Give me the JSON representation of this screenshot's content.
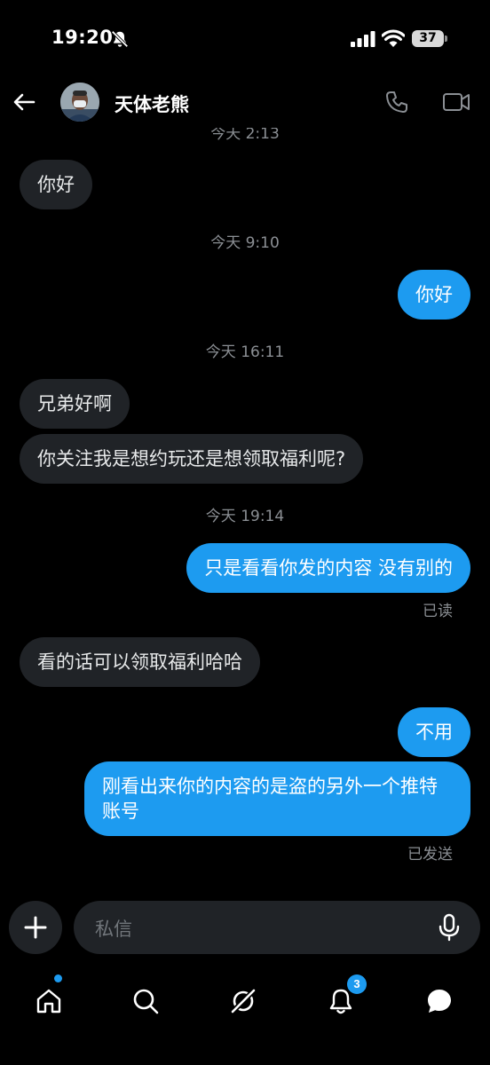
{
  "status_bar": {
    "time": "19:20",
    "battery": "37"
  },
  "header": {
    "contact_name": "天体老熊"
  },
  "messages": [
    {
      "kind": "timestamp",
      "text": "今天 2:13"
    },
    {
      "kind": "incoming",
      "text": "你好"
    },
    {
      "kind": "timestamp",
      "text": "今天 9:10"
    },
    {
      "kind": "outgoing",
      "text": "你好"
    },
    {
      "kind": "timestamp",
      "text": "今天 16:11"
    },
    {
      "kind": "incoming",
      "text": "兄弟好啊"
    },
    {
      "kind": "incoming",
      "text": "你关注我是想约玩还是想领取福利呢?"
    },
    {
      "kind": "timestamp",
      "text": "今天 19:14"
    },
    {
      "kind": "outgoing",
      "text": "只是看看你发的内容 没有别的"
    },
    {
      "kind": "receipt",
      "text": "已读"
    },
    {
      "kind": "incoming",
      "text": "看的话可以领取福利哈哈"
    },
    {
      "kind": "outgoing",
      "text": "不用"
    },
    {
      "kind": "outgoing",
      "text": "刚看出来你的内容的是盗的另外一个推特账号"
    },
    {
      "kind": "receipt",
      "text": "已发送"
    }
  ],
  "composer": {
    "placeholder": "私信"
  },
  "bottom_nav": {
    "items": [
      "home-icon",
      "search-icon",
      "grok-icon",
      "notifications-icon",
      "messages-icon"
    ],
    "notification_count": "3"
  },
  "colors": {
    "accent": "#1d9bf0",
    "bubble_incoming": "#202327",
    "background": "#000000",
    "muted_text": "#8b8f94"
  }
}
